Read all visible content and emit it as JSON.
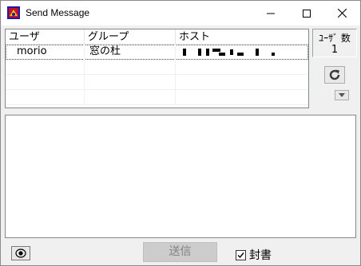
{
  "window": {
    "title": "Send Message"
  },
  "list": {
    "headers": [
      "ユーザ",
      "グループ",
      "ホスト"
    ],
    "rows": [
      {
        "user": "morio",
        "group": "窓の杜",
        "host": ""
      }
    ]
  },
  "user_count": {
    "label": "ﾕｰｻﾞ 数",
    "value": "1"
  },
  "buttons": {
    "send": "送信"
  },
  "seal": {
    "label": "封書",
    "checked": true
  },
  "icons": {
    "app": "app-icon",
    "minimize": "minimize-icon",
    "maximize": "maximize-icon",
    "close": "close-icon",
    "refresh": "refresh-icon",
    "dropdown": "chevron-down-icon",
    "capture": "camera-icon"
  }
}
